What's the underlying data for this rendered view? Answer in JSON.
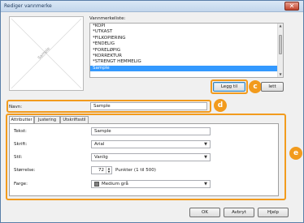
{
  "window": {
    "title": "Rediger vannmerke",
    "close_glyph": "✕"
  },
  "preview": {
    "watermark_text": "Sample"
  },
  "watermark_list": {
    "label": "Vannmerkeliste:",
    "items": [
      {
        "label": "*KOPI",
        "selected": false
      },
      {
        "label": "*UTKAST",
        "selected": false
      },
      {
        "label": "*FILKOPIERING",
        "selected": false
      },
      {
        "label": "*ENDELIG",
        "selected": false
      },
      {
        "label": "*FORELØPIG",
        "selected": false
      },
      {
        "label": "*KORREKTUR",
        "selected": false
      },
      {
        "label": "*STRENGT HEMMELIG",
        "selected": false
      },
      {
        "label": "Sample",
        "selected": true
      }
    ]
  },
  "buttons": {
    "add": "Legg til",
    "delete": "lett",
    "ok": "OK",
    "cancel": "Avbryt",
    "help": "Hjelp"
  },
  "callouts": {
    "c": "c",
    "d": "d",
    "e": "e",
    "color": "#f29b1d"
  },
  "name_field": {
    "label": "Navn:",
    "value": "Sample"
  },
  "tabs": [
    {
      "label": "Attributter",
      "active": true
    },
    {
      "label": "Justering",
      "active": false
    },
    {
      "label": "Utskriftsstil",
      "active": false
    }
  ],
  "attributes": {
    "text_label": "Tekst:",
    "text_value": "Sample",
    "font_label": "Skrift:",
    "font_value": "Arial",
    "style_label": "Stil:",
    "style_value": "Vanlig",
    "size_label": "Størrelse:",
    "size_value": "72",
    "size_hint": "Punkter (1 til 500)",
    "color_label": "Farge:",
    "color_value": "Medium grå",
    "color_swatch": "#808080"
  }
}
